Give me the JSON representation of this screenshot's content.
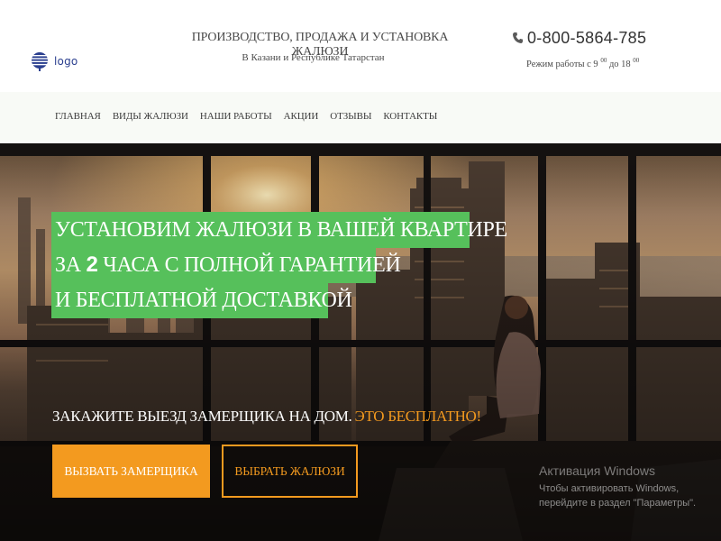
{
  "header": {
    "logo_text": "logo",
    "tagline": "ПРОИЗВОДСТВО, ПРОДАЖА И УСТАНОВКА ЖАЛЮЗИ",
    "subtagline": "В Казани и Республике Татарстан",
    "phone": "0-800-5864-785",
    "hours": {
      "prefix": "Режим работы с 9",
      "sup1": "00",
      "middle": " до 18",
      "sup2": "00"
    }
  },
  "nav": {
    "items": [
      {
        "label": "ГЛАВНАЯ"
      },
      {
        "label": "ВИДЫ ЖАЛЮЗИ"
      },
      {
        "label": "НАШИ РАБОТЫ"
      },
      {
        "label": "АКЦИИ"
      },
      {
        "label": "ОТЗЫВЫ"
      },
      {
        "label": "КОНТАКТЫ"
      }
    ]
  },
  "hero": {
    "headline": {
      "line1": "УСТАНОВИМ ЖАЛЮЗИ В ВАШЕЙ КВАРТИРЕ",
      "line2_prefix": "ЗА",
      "line2_bold": "2",
      "line2_suffix": "ЧАСА С ПОЛНОЙ ГАРАНТИЕЙ",
      "line3": "И БЕСПЛАТНОЙ ДОСТАВКОЙ"
    },
    "cta_text": "ЗАКАЖИТЕ ВЫЕЗД ЗАМЕРЩИКА НА ДОМ.",
    "cta_free": "ЭТО БЕСПЛАТНО!",
    "btn_primary": "ВЫЗВАТЬ ЗАМЕРЩИКА",
    "btn_secondary": "ВЫБРАТЬ ЖАЛЮЗИ"
  },
  "windows_activation": {
    "title": "Активация Windows",
    "text": "Чтобы активировать Windows, перейдите в раздел \"Параметры\"."
  },
  "colors": {
    "accent_orange": "#f39a1f",
    "headline_green": "#56c05b",
    "logo_blue": "#2b3f8f",
    "nav_bg": "#f8faf6"
  },
  "icons": {
    "logo": "globe-logo-icon",
    "phone": "phone-icon"
  }
}
